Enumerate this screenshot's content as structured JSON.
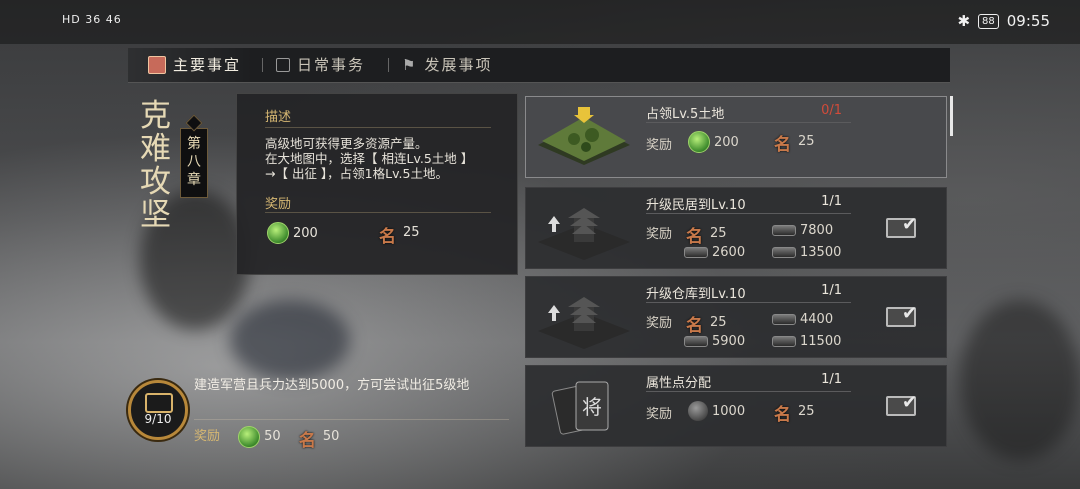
{
  "status_bar": {
    "left": "HD 36 46",
    "time": "09:55",
    "battery": "88"
  },
  "tabs": [
    {
      "label": "主要事宜",
      "icon": "scroll-icon",
      "active": true
    },
    {
      "label": "日常事务",
      "icon": "calendar-icon",
      "active": false
    },
    {
      "label": "发展事项",
      "icon": "flag-icon",
      "active": false
    }
  ],
  "chapter": {
    "title": "克难攻坚",
    "tag": "第八章"
  },
  "description": {
    "heading": "描述",
    "text": "高级地可获得更多资源产量。\n在大地图中，选择【 相连Lv.5土地 】\n→【 出征 】，占领1格Lv.5土地。",
    "reward_label": "奖励",
    "rewards": [
      {
        "icon": "jade-icon",
        "value": "200"
      },
      {
        "icon": "fame-icon",
        "value": "25"
      }
    ]
  },
  "main_task": {
    "progress": "9/10",
    "text": "建造军营且兵力达到5000，方可尝试出征5级地",
    "reward_label": "奖励",
    "rewards": [
      {
        "icon": "jade-icon",
        "value": "50"
      },
      {
        "icon": "fame-icon",
        "value": "50"
      }
    ]
  },
  "quests": [
    {
      "title": "占领Lv.5土地",
      "progress": "0/1",
      "reward_label": "奖励",
      "rewards": [
        {
          "icon": "jade-icon",
          "value": "200"
        },
        {
          "icon": "fame-icon",
          "value": "25"
        }
      ],
      "claimable": false
    },
    {
      "title": "升级民居到Lv.10",
      "progress": "1/1",
      "reward_label": "奖励",
      "rewards": [
        {
          "icon": "fame-icon",
          "value": "25"
        },
        {
          "icon": "wood-icon",
          "value": "7800"
        },
        {
          "icon": "iron-icon",
          "value": "2600"
        },
        {
          "icon": "stone-icon",
          "value": "13500"
        }
      ],
      "claimable": true
    },
    {
      "title": "升级仓库到Lv.10",
      "progress": "1/1",
      "reward_label": "奖励",
      "rewards": [
        {
          "icon": "fame-icon",
          "value": "25"
        },
        {
          "icon": "wood-icon",
          "value": "4400"
        },
        {
          "icon": "iron-icon",
          "value": "5900"
        },
        {
          "icon": "stone-icon",
          "value": "11500"
        }
      ],
      "claimable": true
    },
    {
      "title": "属性点分配",
      "progress": "1/1",
      "reward_label": "奖励",
      "rewards": [
        {
          "icon": "coin-icon",
          "value": "1000"
        },
        {
          "icon": "fame-icon",
          "value": "25"
        }
      ],
      "claimable": true
    }
  ],
  "icon_glyphs": {
    "fame": "名",
    "card_char": "将"
  }
}
